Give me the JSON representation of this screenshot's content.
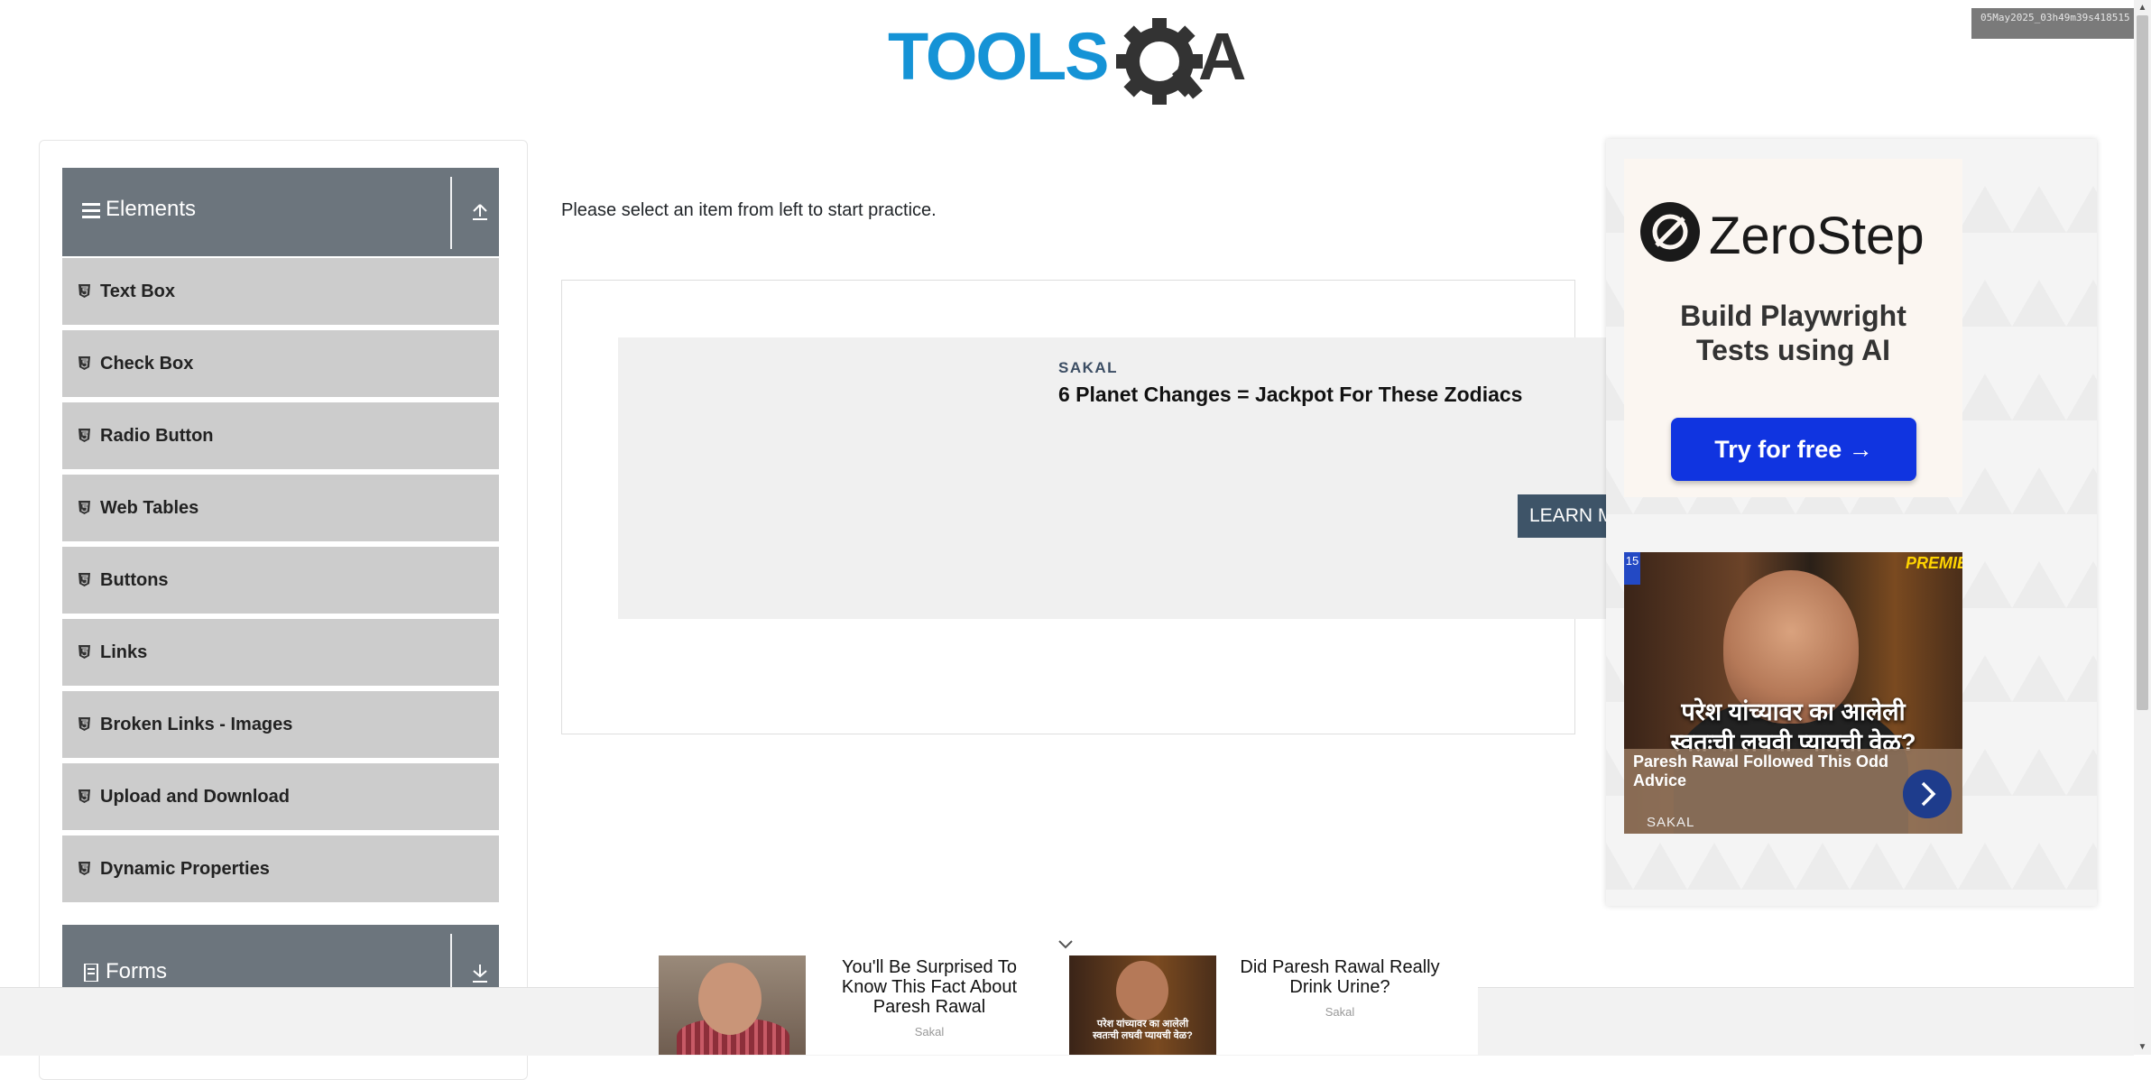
{
  "header": {
    "logo_text": "TOOLSQA",
    "debug_stamp": "05May2025_03h49m39s418515"
  },
  "sidebar": {
    "groups": [
      {
        "title": "Elements",
        "toggle_icon": "chevron-up-icon"
      },
      {
        "title": "Forms",
        "toggle_icon": "chevron-down-icon"
      }
    ],
    "items": [
      {
        "label": "Text Box"
      },
      {
        "label": "Check Box"
      },
      {
        "label": "Radio Button"
      },
      {
        "label": "Web Tables"
      },
      {
        "label": "Buttons"
      },
      {
        "label": "Links"
      },
      {
        "label": "Broken Links - Images"
      },
      {
        "label": "Upload and Download"
      },
      {
        "label": "Dynamic Properties"
      }
    ]
  },
  "main": {
    "intro": "Please select an item from left to start practice.",
    "native_ad": {
      "source": "SAKAL",
      "headline": "6 Planet Changes = Jackpot For These Zodiacs",
      "cta": "LEARN MORE"
    }
  },
  "right_ad": {
    "brand": "ZeroStep",
    "tagline_line1": "Build Playwright",
    "tagline_line2": "Tests using AI",
    "cta": "Try for free →",
    "photo": {
      "marathi_line1": "परेश यांच्यावर का आलेली",
      "marathi_line2": "स्वतःची लघवी प्यायची वेळ?",
      "caption": "Paresh Rawal Followed This Odd Advice",
      "source": "SAKAL",
      "badge": "PREMIE",
      "channel": "15"
    }
  },
  "sticky_ad": {
    "items": [
      {
        "line1": "You'll Be Surprised To",
        "line2": "Know This Fact About",
        "line3": "Paresh Rawal",
        "source": "Sakal"
      },
      {
        "line1": "Did Paresh Rawal Really",
        "line2": "Drink Urine?",
        "source": "Sakal"
      }
    ],
    "thumb2_line1": "परेश यांच्यावर का आलेली",
    "thumb2_line2": "स्वतःची लघवी प्यायची वेळ?"
  },
  "colors": {
    "logo_blue": "#1593d6",
    "logo_dark": "#333333",
    "group_header": "#6c757d",
    "menu_item": "#cccccc",
    "zerostep_button": "#1034e0",
    "learn_more": "#3e5468"
  }
}
